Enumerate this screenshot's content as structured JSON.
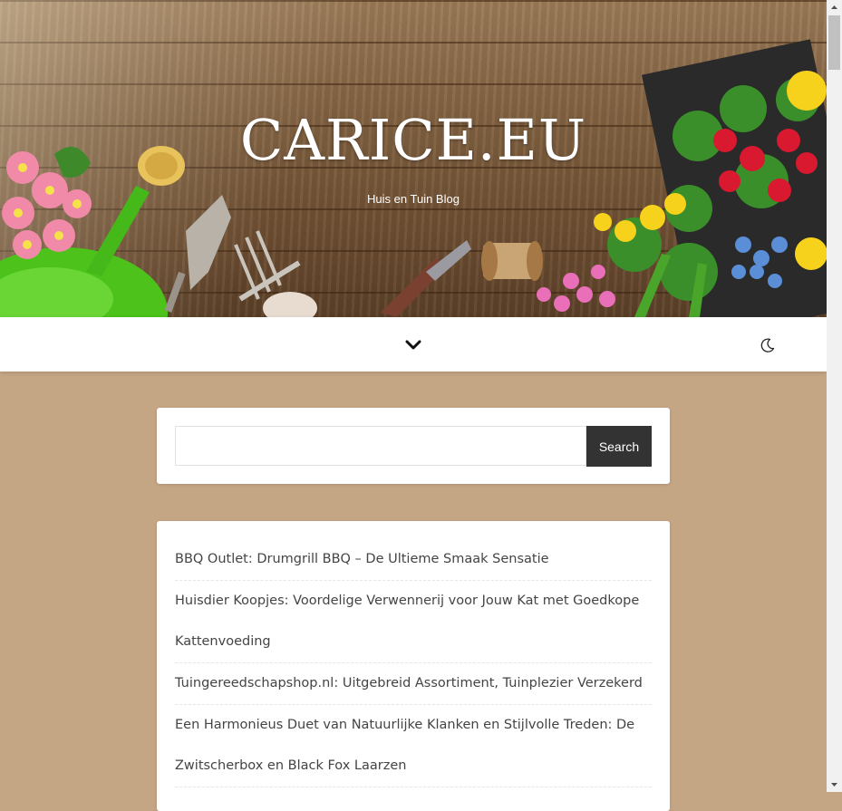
{
  "header": {
    "site_title": "CARICE.EU",
    "tagline": "Huis en Tuin Blog"
  },
  "nav": {
    "menu_icon": "chevron-down-icon",
    "theme_icon": "moon-icon"
  },
  "search": {
    "placeholder": "",
    "value": "",
    "button_label": "Search"
  },
  "recent_posts": [
    "BBQ Outlet: Drumgrill BBQ – De Ultieme Smaak Sensatie",
    "Huisdier Koopjes: Voordelige Verwennerij voor Jouw Kat met Goedkope Kattenvoeding",
    "Tuingereedschapshop.nl: Uitgebreid Assortiment, Tuinplezier Verzekerd",
    "Een Harmonieus Duet van Natuurlijke Klanken en Stijlvolle Treden: De Zwitscherbox en Black Fox Laarzen"
  ],
  "colors": {
    "page_background": "#c4a584",
    "button_background": "#333333",
    "link_text": "#444444"
  }
}
